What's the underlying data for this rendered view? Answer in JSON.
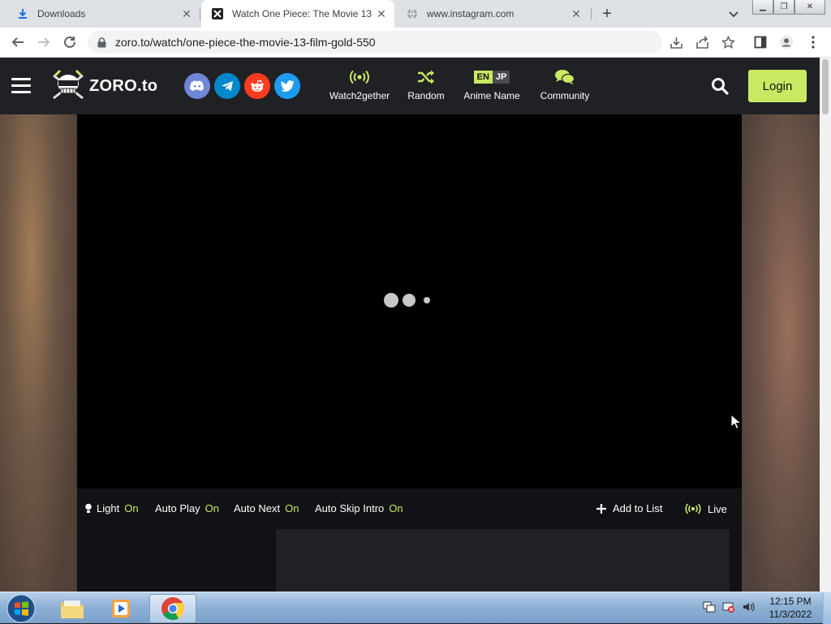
{
  "browser": {
    "tabs": [
      {
        "title": "Downloads",
        "icon": "download-icon",
        "active": false
      },
      {
        "title": "Watch One Piece: The Movie 13 -",
        "icon": "zoro-favicon-icon",
        "active": true
      },
      {
        "title": "www.instagram.com",
        "icon": "globe-icon",
        "active": false
      }
    ],
    "url": "zoro.to/watch/one-piece-the-movie-13-film-gold-550"
  },
  "site": {
    "logo_text": "ZORO.to",
    "social": [
      {
        "name": "discord-icon",
        "color": "#6f85d5"
      },
      {
        "name": "telegram-icon",
        "color": "#0088cc"
      },
      {
        "name": "reddit-icon",
        "color": "#ff3c1f"
      },
      {
        "name": "twitter-icon",
        "color": "#1d9bf0"
      }
    ],
    "nav": {
      "watch2gether": "Watch2gether",
      "random": "Random",
      "anime_name": "Anime Name",
      "lang_en": "EN",
      "lang_jp": "JP",
      "community": "Community"
    },
    "login": "Login",
    "accent": "#cae962"
  },
  "player": {
    "controls": {
      "light": "Light",
      "light_state": "On",
      "auto_play": "Auto Play",
      "auto_play_state": "On",
      "auto_next": "Auto Next",
      "auto_next_state": "On",
      "auto_skip": "Auto Skip Intro",
      "auto_skip_state": "On",
      "add_to_list": "Add to List",
      "live": "Live"
    }
  },
  "taskbar": {
    "time": "12:15 PM",
    "date": "11/3/2022"
  }
}
